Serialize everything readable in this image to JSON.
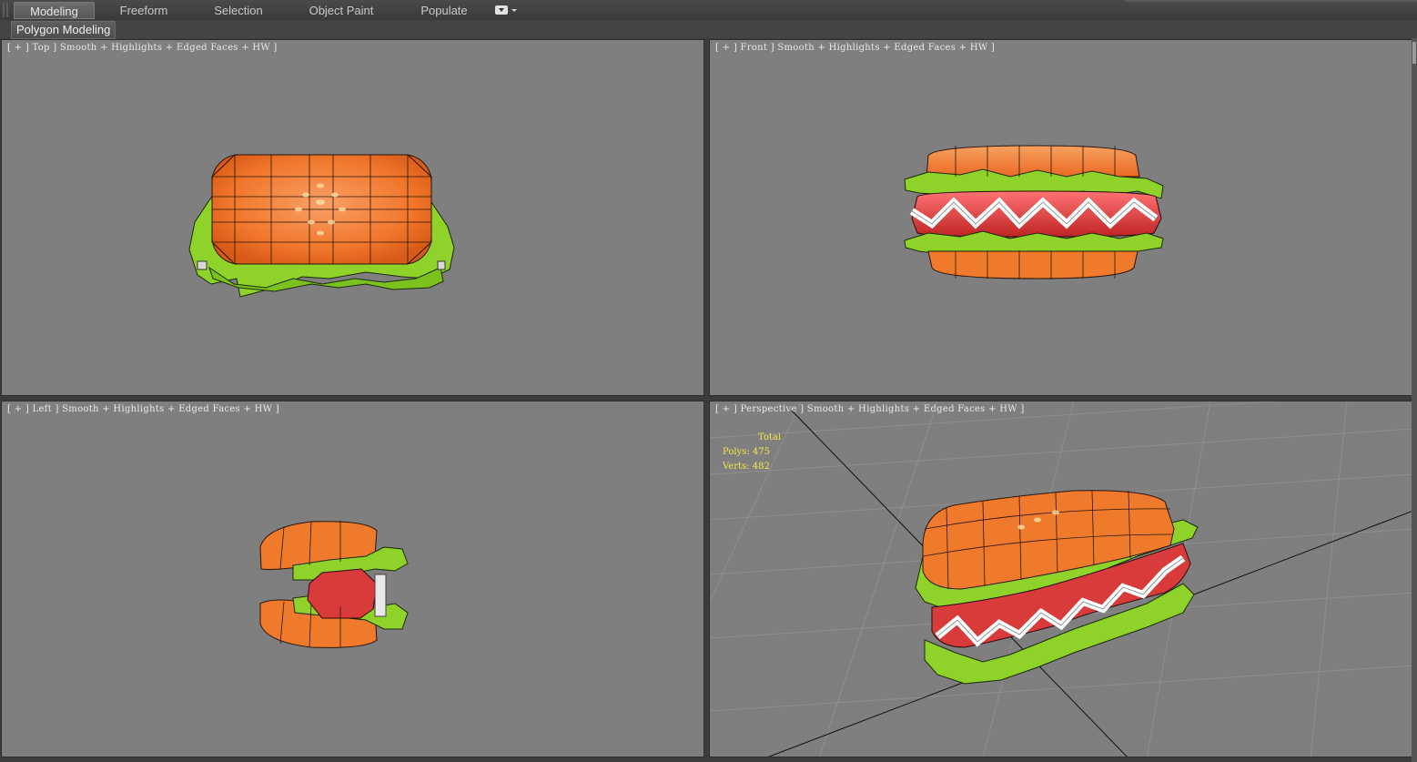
{
  "ribbon": {
    "tabs": [
      {
        "label": "Modeling",
        "active": true
      },
      {
        "label": "Freeform",
        "active": false
      },
      {
        "label": "Selection",
        "active": false
      },
      {
        "label": "Object Paint",
        "active": false
      },
      {
        "label": "Populate",
        "active": false
      }
    ],
    "dropdown_icon": "ribbon-options-icon"
  },
  "panel": {
    "label": "Polygon Modeling"
  },
  "viewports": {
    "top": {
      "label": "[ + ] Top ] Smooth + Highlights + Edged Faces + HW ]"
    },
    "front": {
      "label": "[ + ] Front ] Smooth + Highlights + Edged Faces + HW ]"
    },
    "left": {
      "label": "[ + ] Left ] Smooth + Highlights + Edged Faces + HW ]"
    },
    "perspective": {
      "label": "[ + ] Perspective ] Smooth + Highlights + Edged Faces + HW ]"
    }
  },
  "stats": {
    "total": "Total",
    "polys_label": "Polys:",
    "polys": "475",
    "verts_label": "Verts:",
    "verts": "482"
  },
  "colors": {
    "viewport_bg": "#7f7f7f",
    "bun": "#f07a2a",
    "lettuce": "#8fd32a",
    "sausage": "#d93a3a",
    "ketchup": "#ffffff",
    "stats_text": "#f4e64a"
  }
}
